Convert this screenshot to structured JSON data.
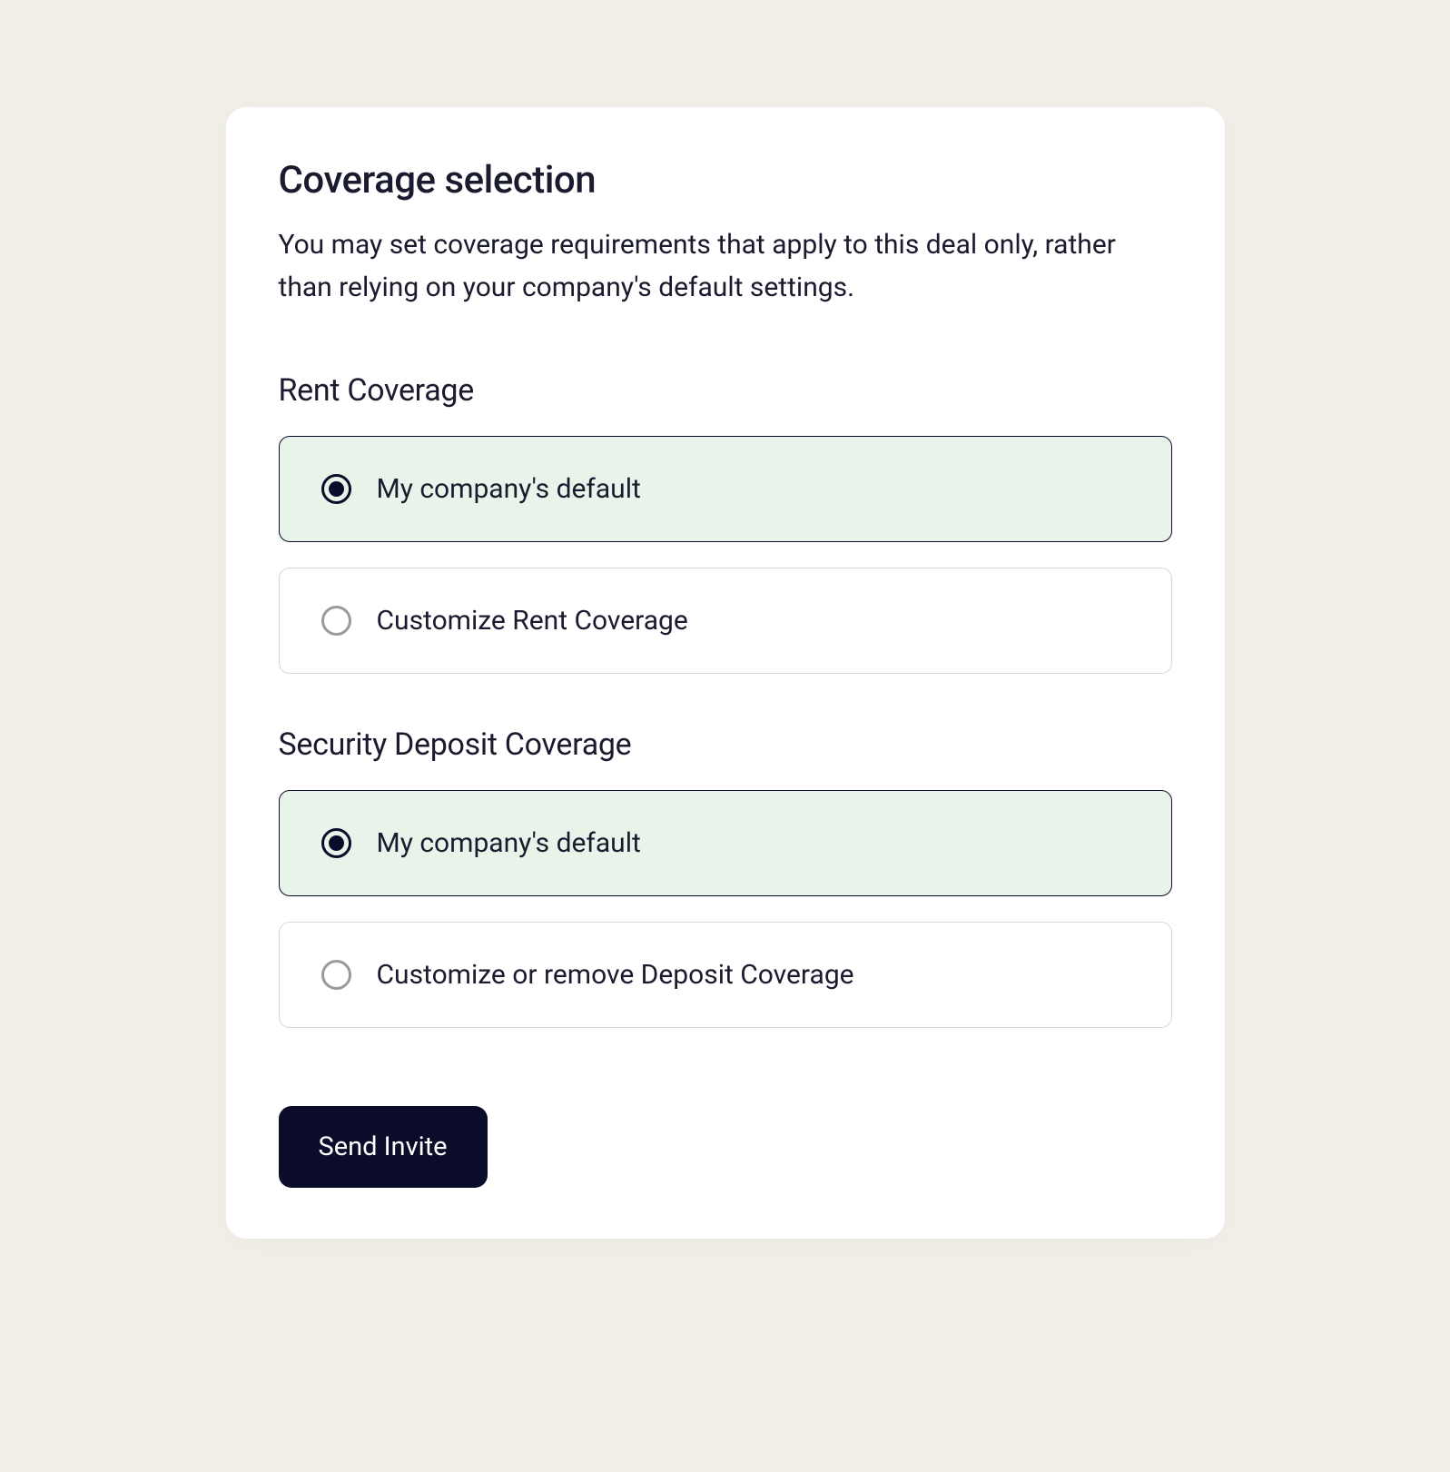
{
  "header": {
    "title": "Coverage selection",
    "subtitle": "You may set coverage requirements that apply to this deal only, rather than relying on your company's default settings."
  },
  "sections": {
    "rent": {
      "heading": "Rent Coverage",
      "options": [
        {
          "label": "My company's default",
          "selected": true
        },
        {
          "label": "Customize Rent Coverage",
          "selected": false
        }
      ]
    },
    "deposit": {
      "heading": "Security Deposit Coverage",
      "options": [
        {
          "label": "My company's default",
          "selected": true
        },
        {
          "label": "Customize or remove Deposit Coverage",
          "selected": false
        }
      ]
    }
  },
  "actions": {
    "submit_label": "Send Invite"
  }
}
